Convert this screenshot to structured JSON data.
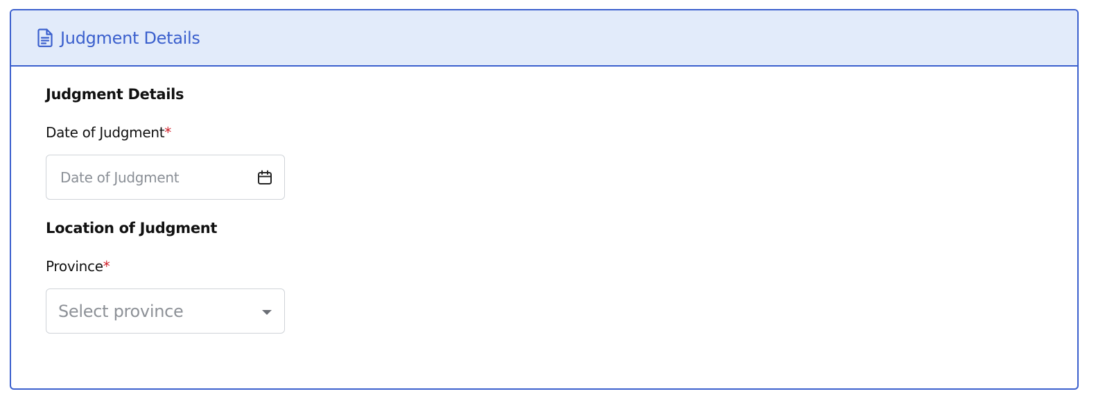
{
  "card": {
    "header_title": "Judgment Details",
    "header_icon": "document-icon",
    "accent_color": "#3a5fcd"
  },
  "sections": {
    "judgment": {
      "title": "Judgment Details",
      "date_field": {
        "label": "Date of Judgment",
        "required_mark": "*",
        "placeholder": "Date of Judgment",
        "icon": "calendar-icon"
      }
    },
    "location": {
      "title": "Location of Judgment",
      "province_field": {
        "label": "Province",
        "required_mark": "*",
        "placeholder": "Select province",
        "icon": "chevron-down-icon"
      }
    }
  }
}
